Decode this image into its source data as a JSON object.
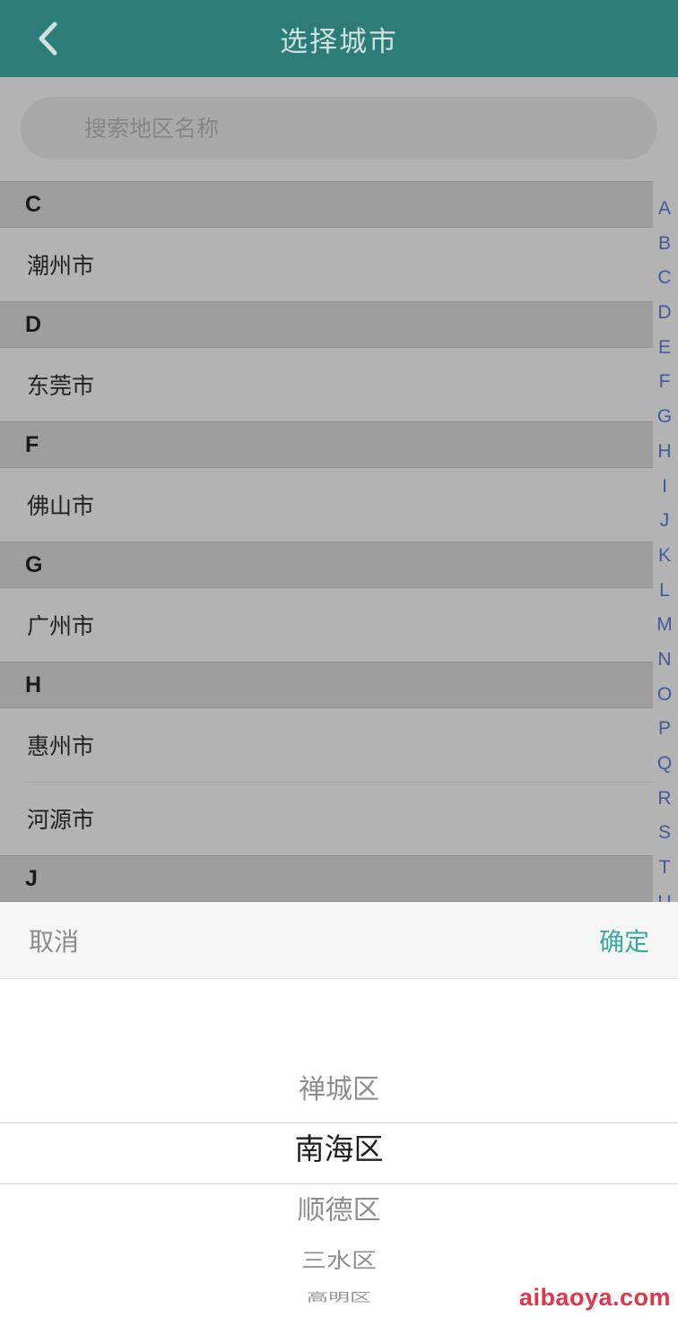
{
  "header": {
    "title": "选择城市"
  },
  "search": {
    "placeholder": "搜索地区名称"
  },
  "sections": [
    {
      "letter": "C",
      "cities": [
        "潮州市"
      ]
    },
    {
      "letter": "D",
      "cities": [
        "东莞市"
      ]
    },
    {
      "letter": "F",
      "cities": [
        "佛山市"
      ]
    },
    {
      "letter": "G",
      "cities": [
        "广州市"
      ]
    },
    {
      "letter": "H",
      "cities": [
        "惠州市",
        "河源市"
      ]
    },
    {
      "letter": "J",
      "cities": []
    }
  ],
  "index_letters": [
    "A",
    "B",
    "C",
    "D",
    "E",
    "F",
    "G",
    "H",
    "I",
    "J",
    "K",
    "L",
    "M",
    "N",
    "O",
    "P",
    "Q",
    "R",
    "S",
    "T",
    "U"
  ],
  "sheet": {
    "cancel_label": "取消",
    "confirm_label": "确定",
    "options": [
      "禅城区",
      "南海区",
      "顺德区",
      "三水区",
      "高明区"
    ],
    "selected_index": 1
  },
  "watermark": "aibaoya.com",
  "colors": {
    "header_bg": "#2c7d78",
    "confirm": "#3aa99f",
    "index_letter": "#3f5a9a",
    "watermark": "#e0354a"
  }
}
